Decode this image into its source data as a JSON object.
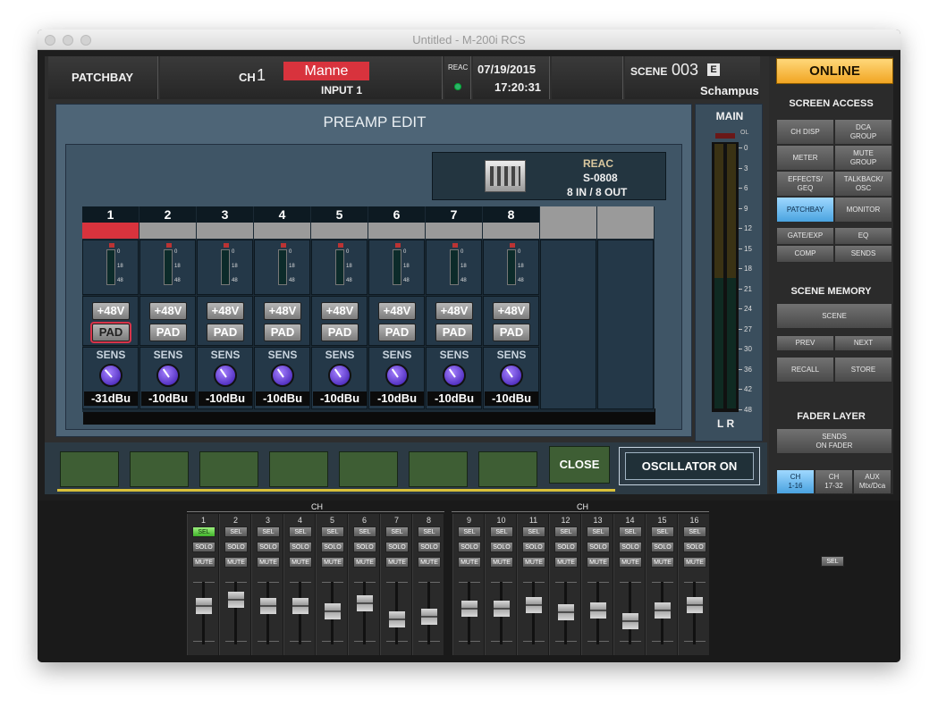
{
  "window": {
    "title": "Untitled - M-200i RCS"
  },
  "header": {
    "patchbay_label": "PATCHBAY",
    "ch_prefix": "CH",
    "ch_number": "1",
    "ch_name": "Manne",
    "input_label": "INPUT 1",
    "reac_label": "REAC",
    "date": "07/19/2015",
    "time": "17:20:31",
    "scene_label": "SCENE",
    "scene_number": "003",
    "scene_flag": "E",
    "scene_name": "Schampus"
  },
  "preamp": {
    "title": "PREAMP EDIT",
    "device": {
      "line1": "REAC",
      "line2": "S-0808",
      "line3": "8 IN /  8 OUT"
    },
    "channels": [
      {
        "num": "1",
        "phantom": "+48V",
        "pad": "PAD",
        "pad_on": true,
        "sens_label": "SENS",
        "gain": "-31dBu",
        "selected": true
      },
      {
        "num": "2",
        "phantom": "+48V",
        "pad": "PAD",
        "pad_on": false,
        "sens_label": "SENS",
        "gain": "-10dBu",
        "selected": false
      },
      {
        "num": "3",
        "phantom": "+48V",
        "pad": "PAD",
        "pad_on": false,
        "sens_label": "SENS",
        "gain": "-10dBu",
        "selected": false
      },
      {
        "num": "4",
        "phantom": "+48V",
        "pad": "PAD",
        "pad_on": false,
        "sens_label": "SENS",
        "gain": "-10dBu",
        "selected": false
      },
      {
        "num": "5",
        "phantom": "+48V",
        "pad": "PAD",
        "pad_on": false,
        "sens_label": "SENS",
        "gain": "-10dBu",
        "selected": false
      },
      {
        "num": "6",
        "phantom": "+48V",
        "pad": "PAD",
        "pad_on": false,
        "sens_label": "SENS",
        "gain": "-10dBu",
        "selected": false
      },
      {
        "num": "7",
        "phantom": "+48V",
        "pad": "PAD",
        "pad_on": false,
        "sens_label": "SENS",
        "gain": "-10dBu",
        "selected": false
      },
      {
        "num": "8",
        "phantom": "+48V",
        "pad": "PAD",
        "pad_on": false,
        "sens_label": "SENS",
        "gain": "-10dBu",
        "selected": false
      }
    ],
    "meter_scale": [
      "0",
      "18",
      "48"
    ]
  },
  "bottom_bar": {
    "close_label": "CLOSE",
    "oscillator_label": "OSCILLATOR ON"
  },
  "main_meter": {
    "title": "MAIN",
    "ol_label": "OL",
    "scale": [
      "0",
      "3",
      "6",
      "9",
      "12",
      "15",
      "18",
      "21",
      "24",
      "27",
      "30",
      "36",
      "42",
      "48"
    ],
    "lr_label": "L R"
  },
  "right_panel": {
    "online_label": "ONLINE",
    "screen_access_title": "SCREEN ACCESS",
    "screen_access": [
      [
        "CH DISP",
        "DCA\nGROUP"
      ],
      [
        "METER",
        "MUTE\nGROUP"
      ],
      [
        "EFFECTS/\nGEQ",
        "TALKBACK/\nOSC"
      ],
      [
        "PATCHBAY",
        "MONITOR"
      ]
    ],
    "aux_buttons": [
      [
        "GATE/EXP",
        "EQ"
      ],
      [
        "COMP",
        "SENDS"
      ]
    ],
    "scene_memory_title": "SCENE MEMORY",
    "scene_button": "SCENE",
    "prev_label": "PREV",
    "next_label": "NEXT",
    "recall_label": "RECALL",
    "store_label": "STORE",
    "fader_layer_title": "FADER LAYER",
    "sends_on_fader": "SENDS\nON FADER",
    "layers": [
      "CH\n1-16",
      "CH\n17-32",
      "AUX\nMtx/Dca"
    ]
  },
  "console": {
    "group_labels": [
      "CH",
      "CH"
    ],
    "strips": [
      {
        "num": "1",
        "sel": "SEL",
        "solo": "SOLO",
        "mute": "MUTE",
        "sel_on": true,
        "fader": 0.7
      },
      {
        "num": "2",
        "sel": "SEL",
        "solo": "SOLO",
        "mute": "MUTE",
        "sel_on": false,
        "fader": 0.82
      },
      {
        "num": "3",
        "sel": "SEL",
        "solo": "SOLO",
        "mute": "MUTE",
        "sel_on": false,
        "fader": 0.7
      },
      {
        "num": "4",
        "sel": "SEL",
        "solo": "SOLO",
        "mute": "MUTE",
        "sel_on": false,
        "fader": 0.7
      },
      {
        "num": "5",
        "sel": "SEL",
        "solo": "SOLO",
        "mute": "MUTE",
        "sel_on": false,
        "fader": 0.6
      },
      {
        "num": "6",
        "sel": "SEL",
        "solo": "SOLO",
        "mute": "MUTE",
        "sel_on": false,
        "fader": 0.75
      },
      {
        "num": "7",
        "sel": "SEL",
        "solo": "SOLO",
        "mute": "MUTE",
        "sel_on": false,
        "fader": 0.45
      },
      {
        "num": "8",
        "sel": "SEL",
        "solo": "SOLO",
        "mute": "MUTE",
        "sel_on": false,
        "fader": 0.5
      },
      {
        "num": "9",
        "sel": "SEL",
        "solo": "SOLO",
        "mute": "MUTE",
        "sel_on": false,
        "fader": 0.65
      },
      {
        "num": "10",
        "sel": "SEL",
        "solo": "SOLO",
        "mute": "MUTE",
        "sel_on": false,
        "fader": 0.65
      },
      {
        "num": "11",
        "sel": "SEL",
        "solo": "SOLO",
        "mute": "MUTE",
        "sel_on": false,
        "fader": 0.72
      },
      {
        "num": "12",
        "sel": "SEL",
        "solo": "SOLO",
        "mute": "MUTE",
        "sel_on": false,
        "fader": 0.58
      },
      {
        "num": "13",
        "sel": "SEL",
        "solo": "SOLO",
        "mute": "MUTE",
        "sel_on": false,
        "fader": 0.62
      },
      {
        "num": "14",
        "sel": "SEL",
        "solo": "SOLO",
        "mute": "MUTE",
        "sel_on": false,
        "fader": 0.42
      },
      {
        "num": "15",
        "sel": "SEL",
        "solo": "SOLO",
        "mute": "MUTE",
        "sel_on": false,
        "fader": 0.62
      },
      {
        "num": "16",
        "sel": "SEL",
        "solo": "SOLO",
        "mute": "MUTE",
        "sel_on": false,
        "fader": 0.72
      }
    ],
    "master_sel": "SEL"
  }
}
